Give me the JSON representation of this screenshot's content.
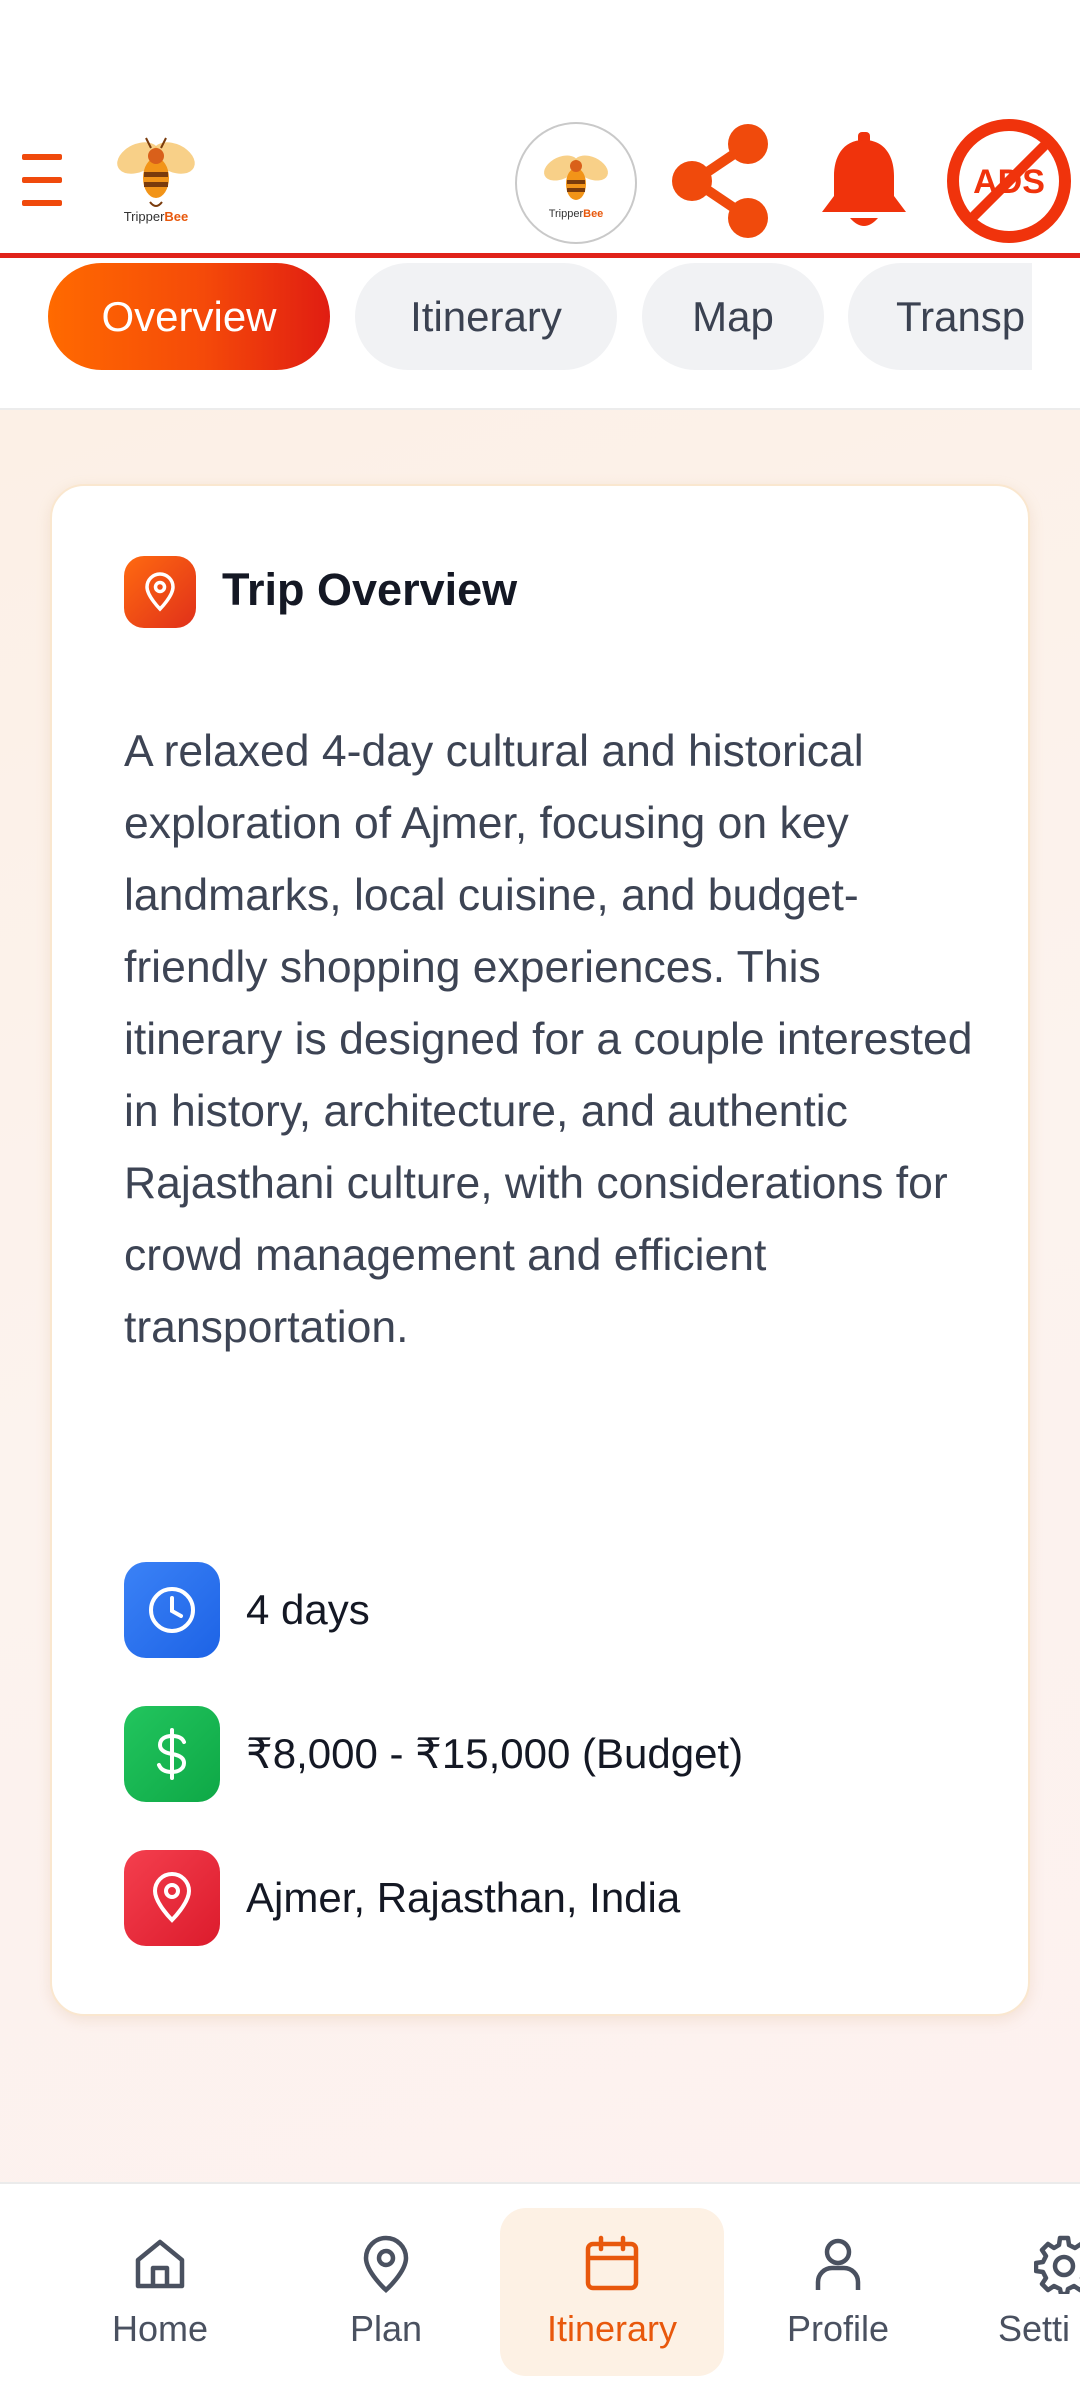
{
  "header": {
    "logo_text_prefix": "Tripper",
    "logo_text_suffix": "Bee",
    "ads_label": "ADS"
  },
  "tabs": [
    {
      "label": "Overview",
      "active": true
    },
    {
      "label": "Itinerary",
      "active": false
    },
    {
      "label": "Map",
      "active": false
    },
    {
      "label": "Transp",
      "active": false
    }
  ],
  "card": {
    "title": "Trip Overview",
    "description": "A relaxed 4-day cultural and historical exploration of Ajmer, focusing on key landmarks, local cuisine, and budget-friendly shopping experiences. This itinerary is designed for a couple interested in history, architecture, and authentic Rajasthani culture, with considerations for crowd management and efficient transportation.",
    "duration": "4 days",
    "budget": "₹8,000 - ₹15,000 (Budget)",
    "location": "Ajmer, Rajasthan, India"
  },
  "bottom_nav": [
    {
      "label": "Home",
      "icon": "home-icon"
    },
    {
      "label": "Plan",
      "icon": "map-pin-icon"
    },
    {
      "label": "Itinerary",
      "icon": "calendar-icon",
      "active": true
    },
    {
      "label": "Profile",
      "icon": "user-icon"
    },
    {
      "label": "Setti",
      "icon": "gear-icon"
    }
  ],
  "colors": {
    "accent": "#f04a0c",
    "header_border": "#e0221a",
    "active_nav_bg": "#fdf1e4",
    "clock_blue": "#1d63e6",
    "budget_green": "#0ea846",
    "location_red": "#dc1b2c"
  }
}
